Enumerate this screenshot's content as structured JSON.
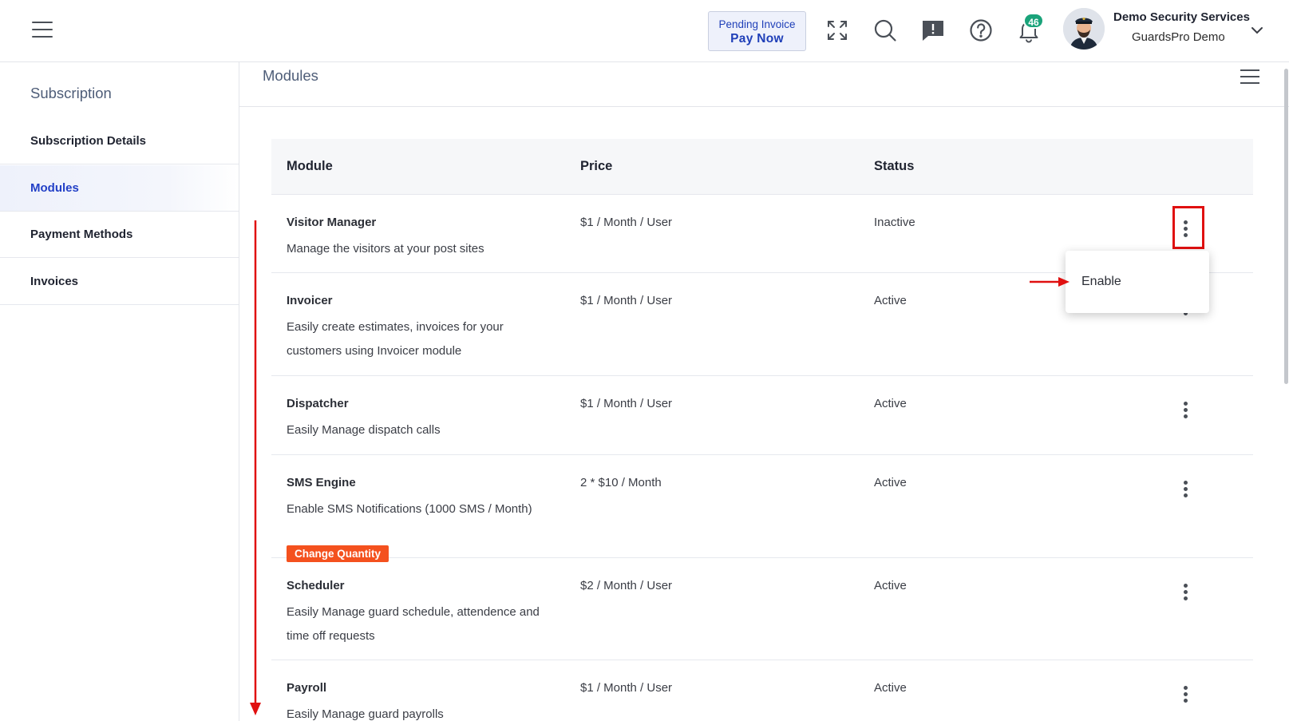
{
  "header": {
    "invoice_line1": "Pending Invoice",
    "invoice_line2": "Pay Now",
    "notification_count": "46",
    "user_name": "Demo Security Services",
    "user_company": "GuardsPro Demo",
    "icons": [
      "menu-icon",
      "fullscreen-icon",
      "search-icon",
      "feedback-icon",
      "help-icon",
      "bell-icon",
      "chevron-down-icon"
    ]
  },
  "sidebar": {
    "title": "Subscription",
    "items": [
      {
        "label": "Subscription Details"
      },
      {
        "label": "Modules"
      },
      {
        "label": "Payment Methods"
      },
      {
        "label": "Invoices"
      }
    ]
  },
  "main": {
    "title": "Modules",
    "columns": [
      "Module",
      "Price",
      "Status"
    ],
    "rows": [
      {
        "name": "Visitor Manager",
        "desc": "Manage the visitors at your post sites",
        "price": "$1 / Month / User",
        "status": "Inactive"
      },
      {
        "name": "Invoicer",
        "desc": "Easily create estimates, invoices for your customers using Invoicer module",
        "price": "$1 / Month / User",
        "status": "Active"
      },
      {
        "name": "Dispatcher",
        "desc": "Easily Manage dispatch calls",
        "price": "$1 / Month / User",
        "status": "Active"
      },
      {
        "name": "SMS Engine",
        "desc": "Enable SMS Notifications (1000 SMS / Month)",
        "price": "2 * $10 / Month",
        "status": "Active",
        "action": "Change Quantity"
      },
      {
        "name": "Scheduler",
        "desc": "Easily Manage guard schedule, attendence and time off requests",
        "price": "$2 / Month / User",
        "status": "Active"
      },
      {
        "name": "Payroll",
        "desc": "Easily Manage guard payrolls",
        "price": "$1 / Month / User",
        "status": "Active"
      }
    ]
  },
  "dropdown": {
    "item": "Enable"
  },
  "colors": {
    "accent": "#2340c7",
    "badge": "#1aa37a",
    "action": "#f4511e",
    "annotation": "#e01010"
  }
}
